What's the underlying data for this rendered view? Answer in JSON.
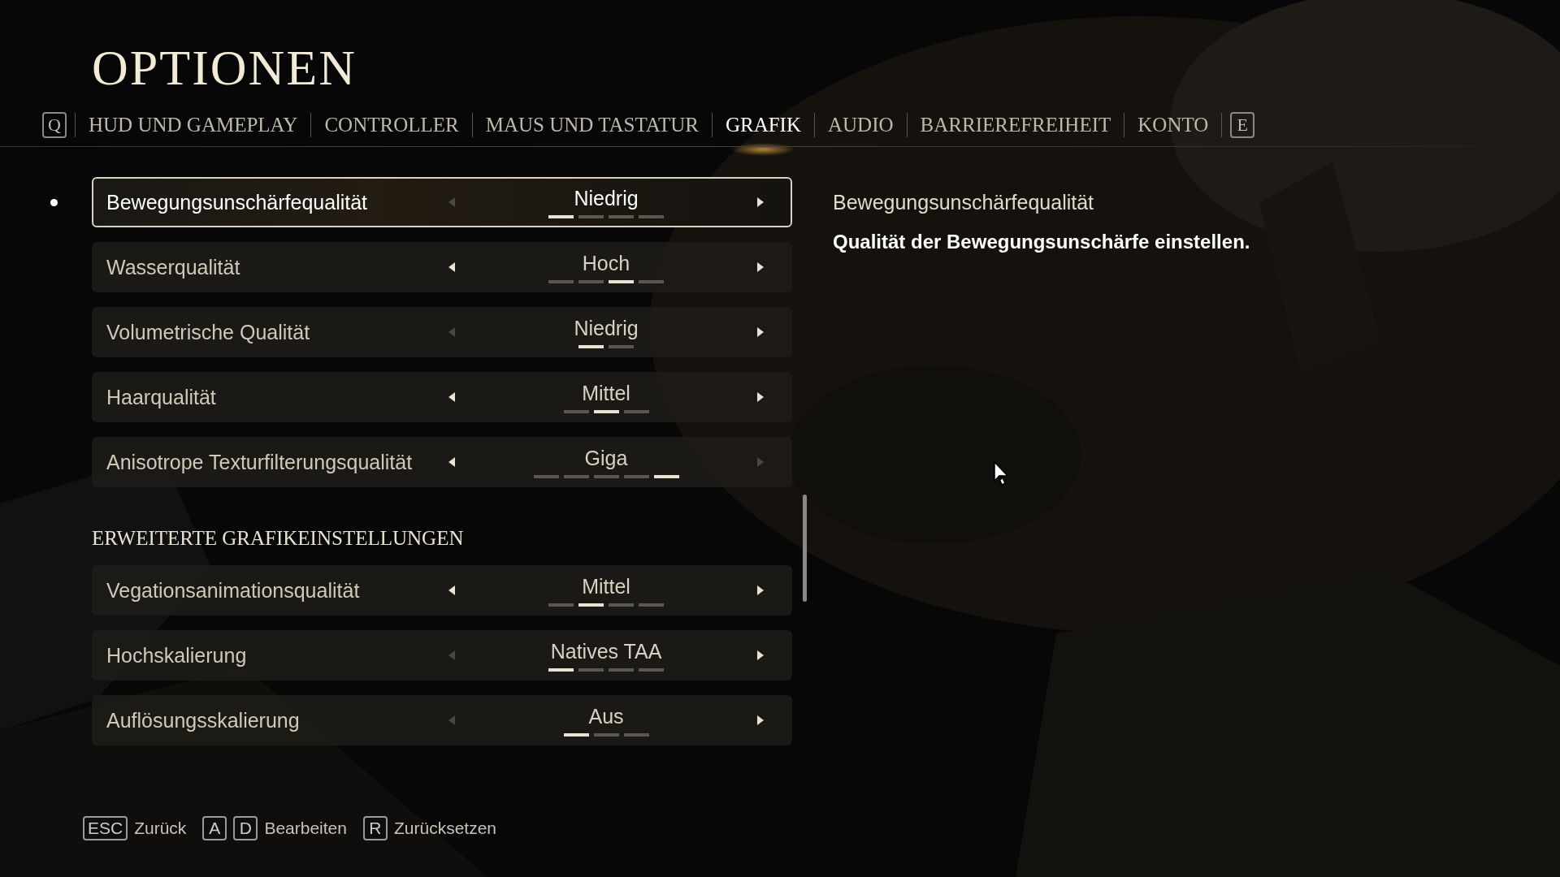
{
  "title": "OPTIONEN",
  "tabs": [
    {
      "kind": "key",
      "label": "Q"
    },
    {
      "kind": "tab",
      "label": "HUD UND GAMEPLAY",
      "selected": false
    },
    {
      "kind": "tab",
      "label": "CONTROLLER",
      "selected": false
    },
    {
      "kind": "tab",
      "label": "MAUS UND TASTATUR",
      "selected": false
    },
    {
      "kind": "tab",
      "label": "GRAFIK",
      "selected": true
    },
    {
      "kind": "tab",
      "label": "AUDIO",
      "selected": false
    },
    {
      "kind": "tab",
      "label": "BARRIEREFREIHEIT",
      "selected": false
    },
    {
      "kind": "tab",
      "label": "KONTO",
      "selected": false
    },
    {
      "kind": "key",
      "label": "E"
    }
  ],
  "settings": [
    {
      "kind": "setting",
      "label": "Bewegungsunschärfequalität",
      "value": "Niedrig",
      "selected": true,
      "steps": [
        {
          "selected": true
        },
        {
          "selected": false
        },
        {
          "selected": false
        },
        {
          "selected": false
        }
      ]
    },
    {
      "kind": "setting",
      "label": "Wasserqualität",
      "value": "Hoch",
      "selected": false,
      "steps": [
        {
          "selected": false
        },
        {
          "selected": false
        },
        {
          "selected": true
        },
        {
          "selected": false
        }
      ]
    },
    {
      "kind": "setting",
      "label": "Volumetrische Qualität",
      "value": "Niedrig",
      "selected": false,
      "steps": [
        {
          "selected": true
        },
        {
          "selected": false
        }
      ]
    },
    {
      "kind": "setting",
      "label": "Haarqualität",
      "value": "Mittel",
      "selected": false,
      "steps": [
        {
          "selected": false
        },
        {
          "selected": true
        },
        {
          "selected": false
        }
      ]
    },
    {
      "kind": "setting",
      "label": "Anisotrope Texturfilterungsqualität",
      "value": "Giga",
      "selected": false,
      "steps": [
        {
          "selected": false
        },
        {
          "selected": false
        },
        {
          "selected": false
        },
        {
          "selected": false
        },
        {
          "selected": true
        }
      ]
    },
    {
      "kind": "heading",
      "label": "ERWEITERTE GRAFIKEINSTELLUNGEN"
    },
    {
      "kind": "setting",
      "label": "Vegationsanimationsqualität",
      "value": "Mittel",
      "selected": false,
      "steps": [
        {
          "selected": false
        },
        {
          "selected": true
        },
        {
          "selected": false
        },
        {
          "selected": false
        }
      ]
    },
    {
      "kind": "setting",
      "label": "Hochskalierung",
      "value": "Natives TAA",
      "selected": false,
      "steps": [
        {
          "selected": true
        },
        {
          "selected": false
        },
        {
          "selected": false
        },
        {
          "selected": false
        }
      ]
    },
    {
      "kind": "setting",
      "label": "Auflösungsskalierung",
      "value": "Aus",
      "selected": false,
      "steps": [
        {
          "selected": true
        },
        {
          "selected": false
        },
        {
          "selected": false
        }
      ]
    }
  ],
  "description": {
    "title": "Bewegungsunschärfequalität",
    "text": "Qualität der Bewegungsunschärfe einstellen."
  },
  "footer": [
    {
      "keys": [
        "ESC"
      ],
      "label": "Zurück"
    },
    {
      "keys": [
        "A",
        "D"
      ],
      "label": "Bearbeiten"
    },
    {
      "keys": [
        "R"
      ],
      "label": "Zurücksetzen"
    }
  ]
}
